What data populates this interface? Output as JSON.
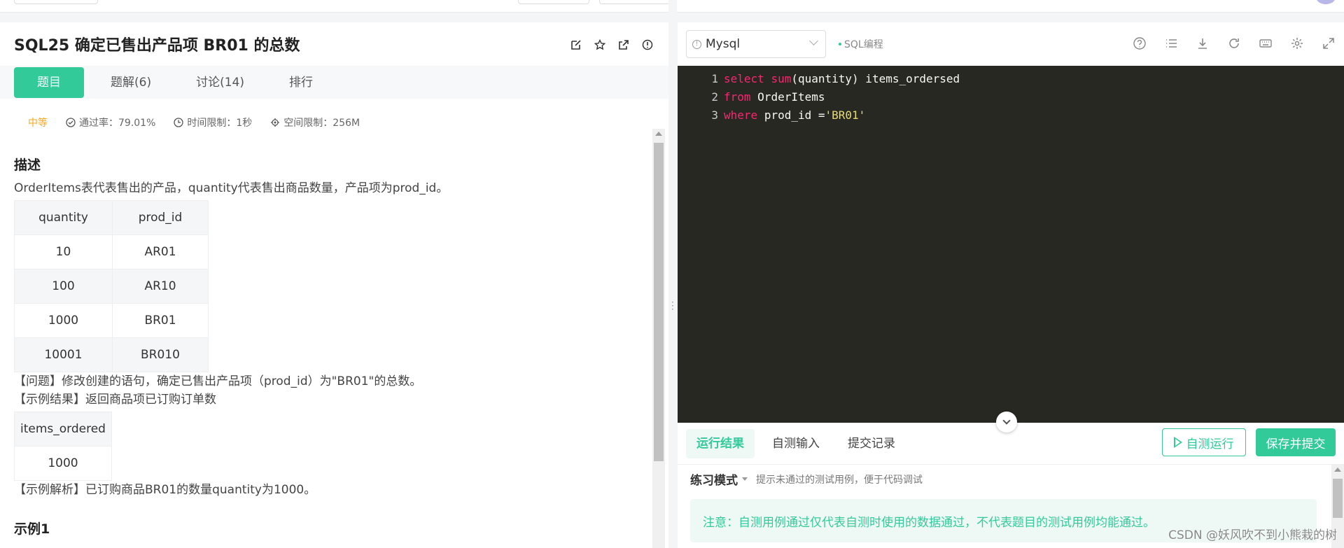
{
  "problem": {
    "title": "SQL25  确定已售出产品项 BR01 的总数",
    "tabs": [
      "题目",
      "题解(6)",
      "讨论(14)",
      "排行"
    ],
    "difficulty": "中等",
    "pass_rate": "通过率：79.01%",
    "time_limit": "时间限制：1秒",
    "space_limit": "空间限制：256M",
    "desc_heading": "描述",
    "desc_text": "OrderItems表代表售出的产品，quantity代表售出商品数量，产品项为prod_id。",
    "table": {
      "headers": [
        "quantity",
        "prod_id"
      ],
      "rows": [
        [
          "10",
          "AR01"
        ],
        [
          "100",
          "AR10"
        ],
        [
          "1000",
          "BR01"
        ],
        [
          "10001",
          "BR010"
        ]
      ]
    },
    "question": "【问题】修改创建的语句，确定已售出产品项（prod_id）为\"BR01\"的总数。",
    "example_result": "【示例结果】返回商品项已订购订单数",
    "result_table": {
      "headers": [
        "items_ordered"
      ],
      "rows": [
        [
          "1000"
        ]
      ]
    },
    "example_explain": "【示例解析】已订购商品BR01的数量quantity为1000。",
    "example1": "示例1"
  },
  "editor": {
    "language": "Mysql",
    "mode": "SQL编程",
    "lines": [
      {
        "no": "1",
        "kw": "select",
        "fn": "sum",
        "rest": "(quantity) items_ordersed"
      },
      {
        "no": "2",
        "kw": "from",
        "rest": "OrderItems"
      },
      {
        "no": "3",
        "kw": "where",
        "rest": "prod_id =",
        "str": "'BR01'"
      }
    ]
  },
  "bottom": {
    "tabs": [
      "运行结果",
      "自测输入",
      "提交记录"
    ],
    "run_button": "自测运行",
    "submit_button": "保存并提交",
    "practice_label": "练习模式",
    "practice_hint": "提示未通过的测试用例，便于代码调试",
    "note": "注意：自测用例通过仅代表自测时使用的数据通过，不代表题目的测试用例均能通过。"
  },
  "watermark": "CSDN @妖风吹不到小熊栽的树",
  "colors": {
    "accent": "#32ca99",
    "editor_bg": "#272822",
    "keyword": "#f92672",
    "string": "#e6db74"
  }
}
